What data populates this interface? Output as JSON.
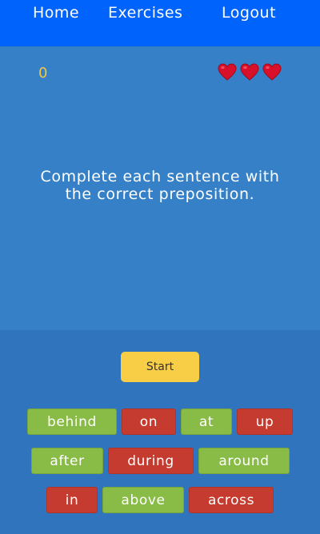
{
  "nav": {
    "home": "Home",
    "exercises": "Exercises",
    "logout": "Logout"
  },
  "game": {
    "score": "0",
    "lives": 3,
    "instruction": "Complete each sentence with the correct preposition."
  },
  "controls": {
    "start_label": "Start"
  },
  "words": [
    {
      "label": "behind",
      "color": "green"
    },
    {
      "label": "on",
      "color": "red"
    },
    {
      "label": "at",
      "color": "green"
    },
    {
      "label": "up",
      "color": "red"
    },
    {
      "label": "after",
      "color": "green"
    },
    {
      "label": "during",
      "color": "red"
    },
    {
      "label": "around",
      "color": "green"
    },
    {
      "label": "in",
      "color": "red"
    },
    {
      "label": "above",
      "color": "green"
    },
    {
      "label": "across",
      "color": "red"
    }
  ],
  "colors": {
    "navbar": "#0063fb",
    "panel": "#3580c6",
    "background": "#2f74bd",
    "score": "#f5c842",
    "start": "#f9ce47",
    "green": "#89bb47",
    "red": "#c63b2f",
    "heart": "#d8102a"
  }
}
